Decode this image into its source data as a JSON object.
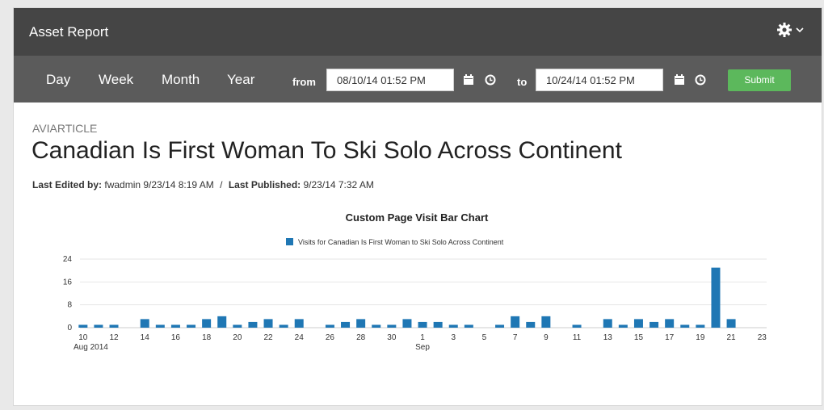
{
  "header": {
    "title": "Asset Report"
  },
  "toolbar": {
    "periods": [
      "Day",
      "Week",
      "Month",
      "Year"
    ],
    "from_label": "from",
    "from_value": "08/10/14 01:52 PM",
    "to_label": "to",
    "to_value": "10/24/14 01:52 PM",
    "submit_label": "Submit"
  },
  "asset": {
    "type": "AVIARTICLE",
    "title": "Canadian Is First Woman To Ski Solo Across Continent",
    "edited_label": "Last Edited by:",
    "edited_value": "fwadmin 9/23/14 8:19 AM",
    "separator": "/",
    "published_label": "Last Published:",
    "published_value": "9/23/14 7:32 AM"
  },
  "colors": {
    "bar": "#1f77b4",
    "submit": "#5cb85c",
    "header": "#454545",
    "toolbar": "#5b5b5b"
  },
  "chart_data": {
    "type": "bar",
    "title": "Custom Page Visit Bar Chart",
    "legend_position": "top-center",
    "grid": true,
    "ylim": [
      0,
      24
    ],
    "y_ticks": [
      "0",
      "8",
      "16",
      "24"
    ],
    "x_ticks": [
      "10",
      "12",
      "14",
      "16",
      "18",
      "20",
      "22",
      "24",
      "26",
      "28",
      "30",
      "1",
      "3",
      "5",
      "7",
      "9",
      "11",
      "13",
      "15",
      "17",
      "19",
      "21",
      "23"
    ],
    "x_month_labels": [
      "Aug 2014",
      "Sep"
    ],
    "series": [
      {
        "name": "Visits for Canadian Is First Woman to Ski Solo Across Continent",
        "color": "#1f77b4",
        "dates": [
          "8/10",
          "8/11",
          "8/12",
          "8/13",
          "8/14",
          "8/15",
          "8/16",
          "8/17",
          "8/18",
          "8/19",
          "8/20",
          "8/21",
          "8/22",
          "8/23",
          "8/24",
          "8/25",
          "8/26",
          "8/27",
          "8/28",
          "8/29",
          "8/30",
          "8/31",
          "9/1",
          "9/2",
          "9/3",
          "9/4",
          "9/5",
          "9/6",
          "9/7",
          "9/8",
          "9/9",
          "9/10",
          "9/11",
          "9/12",
          "9/13",
          "9/14",
          "9/15",
          "9/16",
          "9/17",
          "9/18",
          "9/19",
          "9/20",
          "9/21",
          "9/22",
          "9/23"
        ],
        "values": [
          1,
          1,
          1,
          0,
          3,
          1,
          1,
          1,
          3,
          4,
          1,
          2,
          3,
          1,
          3,
          0,
          1,
          2,
          3,
          1,
          1,
          3,
          2,
          2,
          1,
          1,
          0,
          1,
          4,
          2,
          4,
          0,
          1,
          0,
          3,
          1,
          3,
          2,
          3,
          1,
          1,
          21,
          3,
          0,
          0
        ]
      }
    ]
  }
}
